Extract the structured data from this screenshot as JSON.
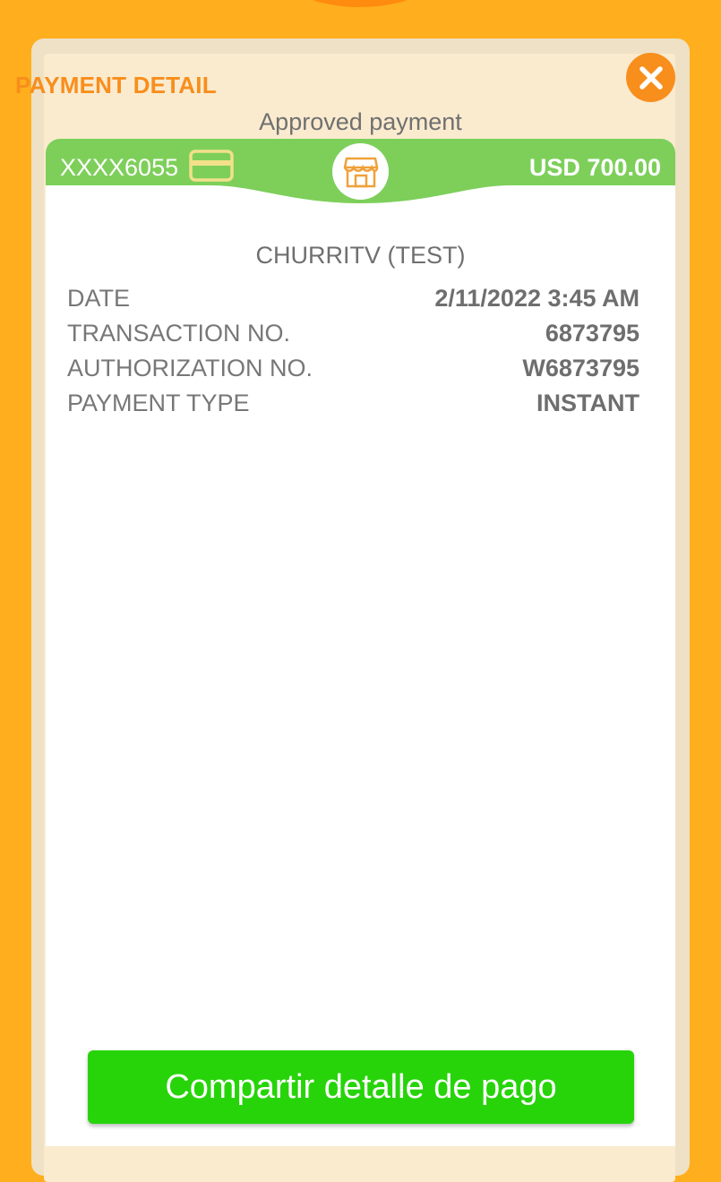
{
  "header": {
    "title": "PAYMENT DETAIL",
    "close_icon": "close-icon",
    "status": "Approved payment"
  },
  "card_band": {
    "card_number": "XXXX6055",
    "card_icon": "credit-card-icon",
    "merchant_icon": "store-icon",
    "amount": "USD 700.00"
  },
  "receipt": {
    "merchant_name": "CHURRITV (TEST)",
    "rows": [
      {
        "label": "DATE",
        "value": "2/11/2022 3:45 AM"
      },
      {
        "label": "TRANSACTION NO.",
        "value": "6873795"
      },
      {
        "label": "AUTHORIZATION NO.",
        "value": "W6873795"
      },
      {
        "label": "PAYMENT TYPE",
        "value": "INSTANT"
      }
    ]
  },
  "actions": {
    "share_label": "Compartir detalle de pago"
  },
  "colors": {
    "background": "#FFAE1D",
    "accent_orange": "#F88E1C",
    "band_green": "#7DCF5A",
    "button_green": "#27D40A"
  }
}
